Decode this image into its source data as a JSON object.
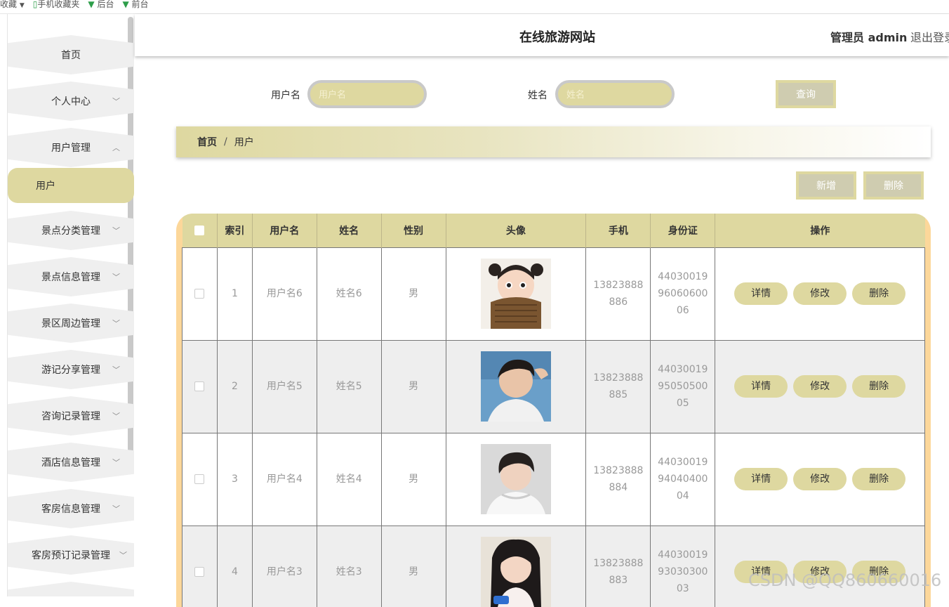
{
  "bookmarks": [
    "收藏",
    "手机收藏夹",
    "后台",
    "前台"
  ],
  "header": {
    "title": "在线旅游网站",
    "admin": "管理员 admin",
    "logout": "退出登录"
  },
  "sidebar": {
    "items": [
      {
        "label": "首页",
        "chevron": ""
      },
      {
        "label": "个人中心",
        "chevron": "﹀"
      },
      {
        "label": "用户管理",
        "chevron": "︿"
      },
      {
        "label": "用户",
        "chevron": ""
      },
      {
        "label": "景点分类管理",
        "chevron": "﹀"
      },
      {
        "label": "景点信息管理",
        "chevron": "﹀"
      },
      {
        "label": "景区周边管理",
        "chevron": "﹀"
      },
      {
        "label": "游记分享管理",
        "chevron": "﹀"
      },
      {
        "label": "咨询记录管理",
        "chevron": "﹀"
      },
      {
        "label": "酒店信息管理",
        "chevron": "﹀"
      },
      {
        "label": "客房信息管理",
        "chevron": "﹀"
      },
      {
        "label": "客房预订记录管理",
        "chevron": "﹀"
      }
    ]
  },
  "search": {
    "username_label": "用户名",
    "username_placeholder": "用户名",
    "name_label": "姓名",
    "name_placeholder": "姓名",
    "query_button": "查询"
  },
  "breadcrumb": {
    "home": "首页",
    "sep": "/",
    "current": "用户"
  },
  "actions": {
    "add": "新增",
    "delete": "删除"
  },
  "table": {
    "headers": [
      "索引",
      "用户名",
      "姓名",
      "性别",
      "头像",
      "手机",
      "身份证",
      "操作"
    ],
    "rows": [
      {
        "index": "1",
        "username": "用户名6",
        "name": "姓名6",
        "gender": "男",
        "phone": [
          "13823888",
          "886"
        ],
        "idcard": [
          "44030019",
          "96060600",
          "06"
        ]
      },
      {
        "index": "2",
        "username": "用户名5",
        "name": "姓名5",
        "gender": "男",
        "phone": [
          "13823888",
          "885"
        ],
        "idcard": [
          "44030019",
          "95050500",
          "05"
        ]
      },
      {
        "index": "3",
        "username": "用户名4",
        "name": "姓名4",
        "gender": "男",
        "phone": [
          "13823888",
          "884"
        ],
        "idcard": [
          "44030019",
          "94040400",
          "04"
        ]
      },
      {
        "index": "4",
        "username": "用户名3",
        "name": "姓名3",
        "gender": "男",
        "phone": [
          "13823888",
          "883"
        ],
        "idcard": [
          "44030019",
          "93030300",
          "03"
        ]
      }
    ],
    "row_buttons": {
      "detail": "详情",
      "edit": "修改",
      "delete": "删除"
    }
  },
  "watermark": "CSDN @QQ860660016",
  "colors": {
    "accent": "#ded8a0",
    "table_frame": "#fcd79a",
    "button_gray": "#cfccb0"
  }
}
